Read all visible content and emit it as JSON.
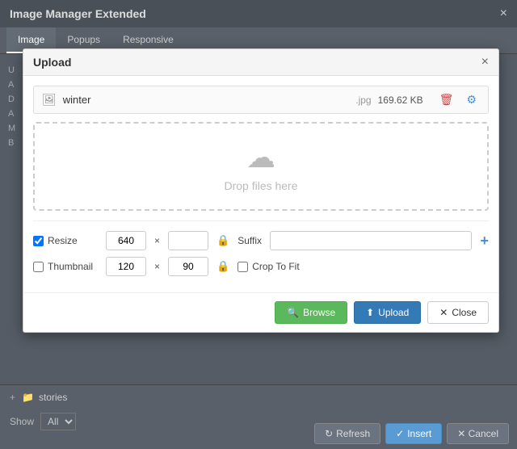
{
  "dialog": {
    "title": "Image Manager Extended",
    "close_label": "×",
    "tabs": [
      {
        "label": "Image",
        "active": true
      },
      {
        "label": "Popups",
        "active": false
      },
      {
        "label": "Responsive",
        "active": false
      }
    ]
  },
  "upload_modal": {
    "title": "Upload",
    "close_label": "×",
    "file": {
      "name": "winter",
      "extension": ".jpg",
      "size": "169.62 KB",
      "icon": "🖼"
    },
    "drop_zone": {
      "text": "Drop files here",
      "icon": "☁"
    },
    "options": {
      "resize_label": "Resize",
      "resize_checked": true,
      "resize_width": "640",
      "resize_height": "",
      "thumbnail_label": "Thumbnail",
      "thumbnail_checked": false,
      "thumb_width": "120",
      "thumb_height": "90",
      "suffix_label": "Suffix",
      "suffix_value": "",
      "crop_label": "Crop To Fit",
      "crop_checked": false
    },
    "footer": {
      "browse_label": "Browse",
      "upload_label": "Upload",
      "close_label": "Close"
    }
  },
  "background": {
    "sidebar_letters": [
      "U",
      "A",
      "D",
      "A",
      "M",
      "B"
    ],
    "bottom": {
      "folder_expand": "+",
      "folder_icon": "📁",
      "folder_name": "stories",
      "show_label": "Show",
      "show_options": [
        "All"
      ],
      "show_selected": "All"
    },
    "actions": {
      "refresh_label": "Refresh",
      "insert_label": "Insert",
      "cancel_label": "Cancel"
    }
  }
}
